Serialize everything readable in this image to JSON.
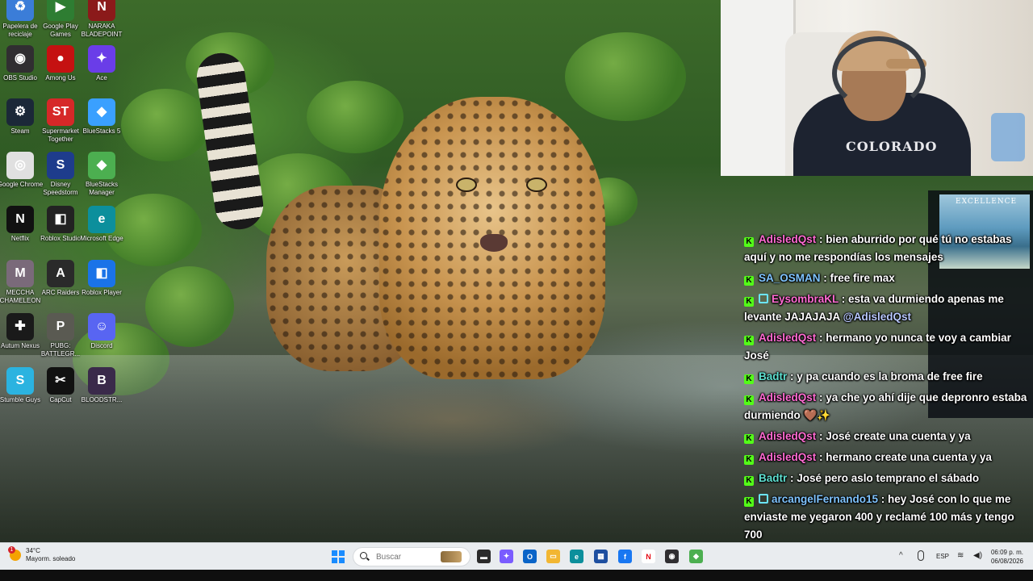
{
  "desktop": {
    "icons": [
      {
        "label": "Papelera de reciclaje",
        "icon": "recycle-bin-icon",
        "color": "#3b7dd8",
        "glyph": "♻"
      },
      {
        "label": "Google Play Games",
        "icon": "play-games-icon",
        "color": "#2e7d32",
        "glyph": "▶"
      },
      {
        "label": "NARAKA BLADEPOINT",
        "icon": "naraka-icon",
        "color": "#8b1a1a",
        "glyph": "N"
      },
      {
        "label": "OBS Studio",
        "icon": "obs-icon",
        "color": "#302e31",
        "glyph": "◉"
      },
      {
        "label": "Among Us",
        "icon": "among-us-icon",
        "color": "#c51111",
        "glyph": "●"
      },
      {
        "label": "Ace",
        "icon": "ace-icon",
        "color": "#6a3de8",
        "glyph": "✦"
      },
      {
        "label": "Steam",
        "icon": "steam-icon",
        "color": "#1b2838",
        "glyph": "⚙"
      },
      {
        "label": "Supermarket Together",
        "icon": "supermarket-icon",
        "color": "#d62828",
        "glyph": "ST"
      },
      {
        "label": "BlueStacks 5",
        "icon": "bluestacks-icon",
        "color": "#3aa0ff",
        "glyph": "◆"
      },
      {
        "label": "Google Chrome",
        "icon": "chrome-icon",
        "color": "#e0e0e0",
        "glyph": "◎"
      },
      {
        "label": "Disney Speedstorm",
        "icon": "speedstorm-icon",
        "color": "#1e3c8c",
        "glyph": "S"
      },
      {
        "label": "BlueStacks Manager",
        "icon": "bluestacks-manager-icon",
        "color": "#4caf50",
        "glyph": "◆"
      },
      {
        "label": "Netflix",
        "icon": "netflix-icon",
        "color": "#111111",
        "glyph": "N"
      },
      {
        "label": "Roblox Studio",
        "icon": "roblox-studio-icon",
        "color": "#222222",
        "glyph": "◧"
      },
      {
        "label": "Microsoft Edge",
        "icon": "edge-icon",
        "color": "#0c8f9c",
        "glyph": "e"
      },
      {
        "label": "MECCHA CHAMELEON",
        "icon": "meccha-chameleon-icon",
        "color": "#7a6a7a",
        "glyph": "M"
      },
      {
        "label": "ARC Raiders",
        "icon": "arc-raiders-icon",
        "color": "#2a2a2a",
        "glyph": "A"
      },
      {
        "label": "Roblox Player",
        "icon": "roblox-player-icon",
        "color": "#1a73e8",
        "glyph": "◧"
      },
      {
        "label": "Autum Nexus",
        "icon": "autum-nexus-icon",
        "color": "#1a1a1a",
        "glyph": "✚"
      },
      {
        "label": "PUBG: BATTLEGR...",
        "icon": "pubg-icon",
        "color": "#5a5a52",
        "glyph": "P"
      },
      {
        "label": "Discord",
        "icon": "discord-icon",
        "color": "#5865f2",
        "glyph": "☺"
      },
      {
        "label": "Stumble Guys",
        "icon": "stumble-guys-icon",
        "color": "#2bb3e0",
        "glyph": "S"
      },
      {
        "label": "CapCut",
        "icon": "capcut-icon",
        "color": "#111111",
        "glyph": "✂"
      },
      {
        "label": "BLOODSTR...",
        "icon": "bloodstrike-icon",
        "color": "#3a2a4a",
        "glyph": "B"
      }
    ]
  },
  "webcam": {
    "hoodie_text": "COLORADO"
  },
  "overlay": {
    "thumb_title": "EXCELLENCE"
  },
  "chat": {
    "messages": [
      {
        "user": "AdisledQst",
        "user_color": "#ff6bd2",
        "badge2": false,
        "text": "bien aburrido por qué tú no estabas aquí y no me respondías los mensajes",
        "mention": ""
      },
      {
        "user": "SA_OSMAN",
        "user_color": "#7fc4ff",
        "badge2": false,
        "text": "free fire max",
        "mention": ""
      },
      {
        "user": "EysombraKL",
        "user_color": "#ff6bd2",
        "badge2": true,
        "text": "esta va durmiendo apenas me levante JAJAJAJA",
        "mention": "@AdisledQst"
      },
      {
        "user": "AdisledQst",
        "user_color": "#ff6bd2",
        "badge2": false,
        "text": "hermano yo nunca te voy a cambiar José",
        "mention": ""
      },
      {
        "user": "Badtr",
        "user_color": "#5ee0d0",
        "badge2": false,
        "text": "y pa cuando es la broma de free fire",
        "mention": ""
      },
      {
        "user": "AdisledQst",
        "user_color": "#ff6bd2",
        "badge2": false,
        "text": "ya che yo ahí dije que depronro estaba durmiendo 🤎✨",
        "mention": ""
      },
      {
        "user": "AdisledQst",
        "user_color": "#ff6bd2",
        "badge2": false,
        "text": "José create una cuenta y ya",
        "mention": ""
      },
      {
        "user": "AdisledQst",
        "user_color": "#ff6bd2",
        "badge2": false,
        "text": "hermano create una cuenta y ya",
        "mention": ""
      },
      {
        "user": "Badtr",
        "user_color": "#5ee0d0",
        "badge2": false,
        "text": "José pero aslo temprano el sábado",
        "mention": ""
      },
      {
        "user": "arcangelFernando15",
        "user_color": "#7fc4ff",
        "badge2": true,
        "text": "hey José con lo que me enviaste me yegaron 400 y reclamé 100 más y tengo 700",
        "mention": ""
      }
    ]
  },
  "taskbar": {
    "weather": {
      "temp": "34°C",
      "desc": "Mayorm. soleado",
      "badge": "1"
    },
    "search_placeholder": "Buscar",
    "apps": [
      {
        "icon": "file-explorer-dark-icon",
        "color": "#2b2b2b",
        "glyph": "▬"
      },
      {
        "icon": "copilot-icon",
        "color": "#7a5cff",
        "glyph": "✦"
      },
      {
        "icon": "outlook-icon",
        "color": "#0a64c8",
        "glyph": "O"
      },
      {
        "icon": "file-explorer-icon",
        "color": "#f2b632",
        "glyph": "▭"
      },
      {
        "icon": "edge-taskbar-icon",
        "color": "#0c8f9c",
        "glyph": "e"
      },
      {
        "icon": "store-icon",
        "color": "#1e4fa0",
        "glyph": "▦"
      },
      {
        "icon": "facebook-icon",
        "color": "#1877f2",
        "glyph": "f"
      },
      {
        "icon": "netflix-taskbar-icon",
        "color": "#ffffff",
        "glyph": "N"
      },
      {
        "icon": "obs-taskbar-icon",
        "color": "#302e31",
        "glyph": "◉"
      },
      {
        "icon": "bluestacks-taskbar-icon",
        "color": "#4caf50",
        "glyph": "◆"
      }
    ],
    "tray": {
      "lang": "ESP",
      "chevron": "^"
    },
    "clock": {
      "time": "06:09 p. m.",
      "date": "06/08/2026"
    }
  }
}
